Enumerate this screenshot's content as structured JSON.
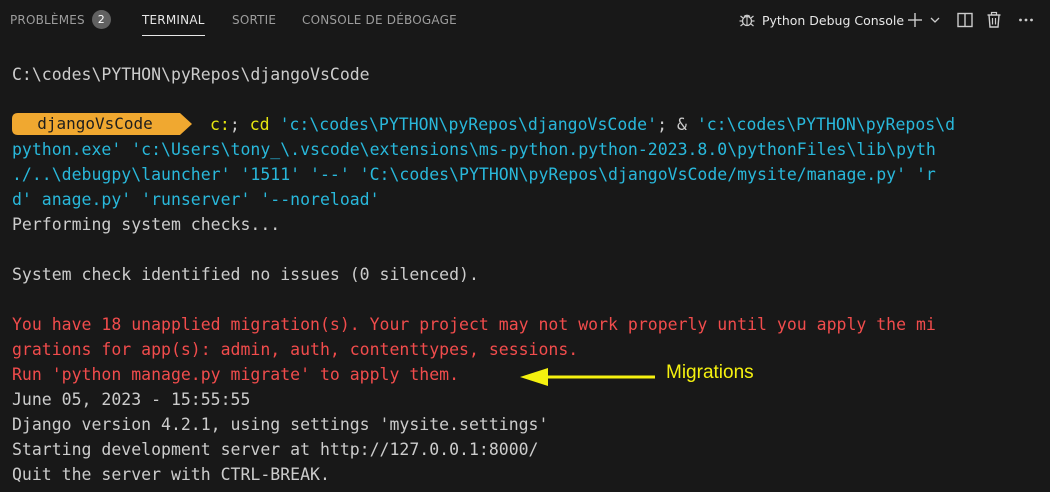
{
  "panel": {
    "tabs": [
      {
        "label": "PROBLÈMES",
        "badge": "2"
      },
      {
        "label": "TERMINAL",
        "active": true
      },
      {
        "label": "SORTIE"
      },
      {
        "label": "CONSOLE DE DÉBOGAGE"
      }
    ],
    "terminal_name": "Python Debug Console",
    "icons": [
      "debug-icon",
      "plus-icon",
      "chevron-down-icon",
      "split-icon",
      "trash-icon",
      "ellipsis-icon"
    ]
  },
  "terminal": {
    "path_line": "C:\\codes\\PYTHON\\pyRepos\\djangoVsCode",
    "prompt_label": "djangoVsCode",
    "cmd": {
      "c": "c:",
      "semi1": ";",
      "cd": "cd",
      "arg1": "'c:\\codes\\PYTHON\\pyRepos\\djangoVsCode'",
      "semi2": ";",
      "amp": "&",
      "arg2_start": "'c:\\codes\\PYTHON\\pyRepos\\d",
      "line2": "python.exe' 'c:\\Users\\tony_\\.vscode\\extensions\\ms-python.python-2023.8.0\\pythonFiles\\lib\\pyth",
      "line3": "./..\\debugpy\\launcher' '1511' '--' 'C:\\codes\\PYTHON\\pyRepos\\djangoVsCode/mysite/manage.py' 'r",
      "line4": "d' anage.py' 'runserver' '--noreload'"
    },
    "output": {
      "performing": "Performing system checks...",
      "system_check": "System check identified no issues (0 silenced).",
      "warn1": "You have 18 unapplied migration(s). Your project may not work properly until you apply the mi",
      "warn2": "grations for app(s): admin, auth, contenttypes, sessions.",
      "warn3": "Run 'python manage.py migrate' to apply them.",
      "date": "June 05, 2023 - 15:55:55",
      "django_version": "Django version 4.2.1, using settings 'mysite.settings'",
      "starting": "Starting development server at http://127.0.0.1:8000/",
      "quit": "Quit the server with CTRL-BREAK."
    },
    "annotation": "Migrations"
  },
  "colors": {
    "background": "#181818",
    "prompt_pill": "#f0a830",
    "keyword_yellow": "#e5e510",
    "string_blue": "#29b8db",
    "warning_red": "#f14c4c",
    "annotation_yellow": "#f5f10f"
  }
}
